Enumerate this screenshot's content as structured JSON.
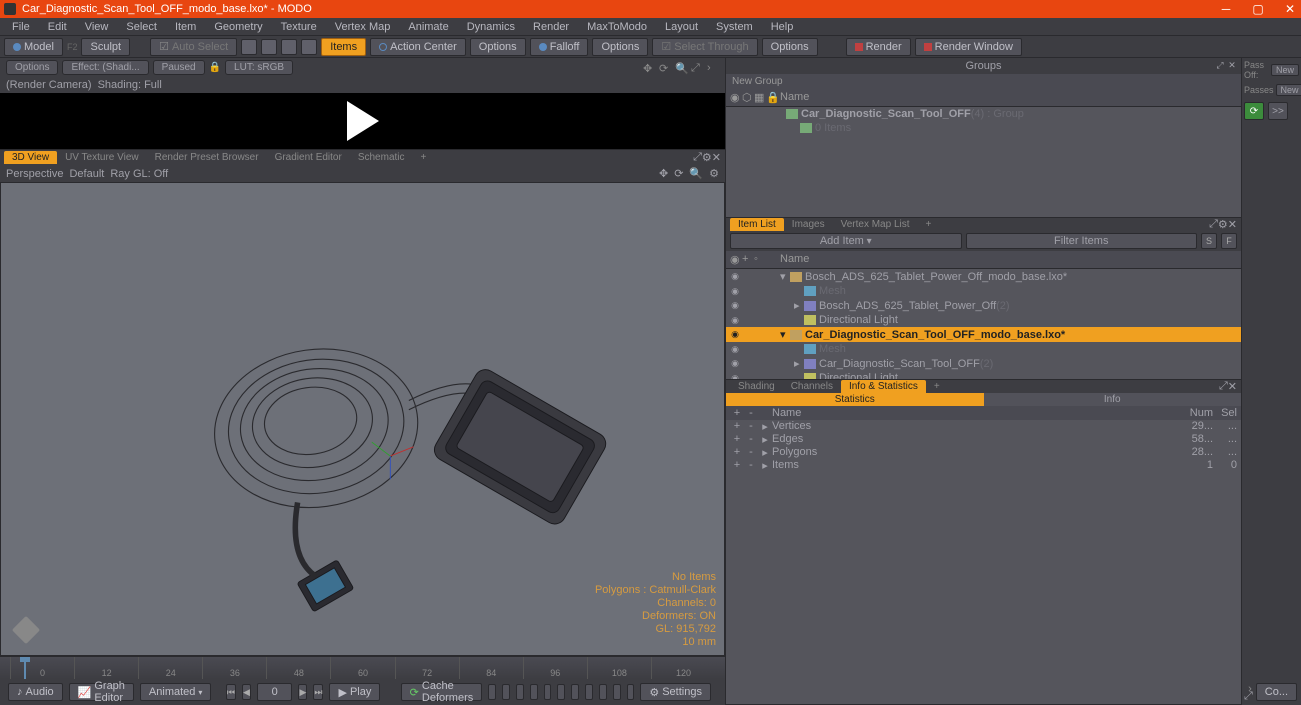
{
  "title": "Car_Diagnostic_Scan_Tool_OFF_modo_base.lxo* - MODO",
  "menus": [
    "File",
    "Edit",
    "View",
    "Select",
    "Item",
    "Geometry",
    "Texture",
    "Vertex Map",
    "Animate",
    "Dynamics",
    "Render",
    "MaxToModo",
    "Layout",
    "System",
    "Help"
  ],
  "toolbar": {
    "model": "Model",
    "model_key": "F2",
    "sculpt": "Sculpt",
    "auto_select": "Auto Select",
    "items": "Items",
    "action_center": "Action Center",
    "options1": "Options",
    "falloff": "Falloff",
    "options2": "Options",
    "select_through": "Select Through",
    "options3": "Options",
    "render": "Render",
    "render_window": "Render Window"
  },
  "preview_bar": {
    "options": "Options",
    "effect": "Effect: (Shadi...",
    "paused": "Paused",
    "lut": "LUT: sRGB",
    "render_camera": "(Render Camera)",
    "shading": "Shading: Full"
  },
  "viewport_tabs": [
    "3D View",
    "UV Texture View",
    "Render Preset Browser",
    "Gradient Editor",
    "Schematic"
  ],
  "viewport_sub": {
    "perspective": "Perspective",
    "default": "Default",
    "raygl": "Ray GL: Off"
  },
  "hud": {
    "no_items": "No Items",
    "polys": "Polygons : Catmull-Clark",
    "channels": "Channels: 0",
    "deformers": "Deformers: ON",
    "gl": "GL: 915,792",
    "grid": "10 mm"
  },
  "timeline": {
    "start": 0,
    "end": 120,
    "major": [
      0,
      12,
      24,
      36,
      48,
      60,
      72,
      84,
      96,
      108,
      120
    ]
  },
  "playbar": {
    "audio": "Audio",
    "graph_editor": "Graph Editor",
    "mode": "Animated",
    "frame": "0",
    "play": "Play",
    "cache": "Cache Deformers",
    "settings": "Settings"
  },
  "groups": {
    "title": "Groups",
    "new_group": "New Group",
    "header_name": "Name",
    "rows": [
      {
        "name": "Car_Diagnostic_Scan_Tool_OFF",
        "suffix": "(4) : Group"
      },
      {
        "name": "",
        "suffix": "0 Items",
        "indent": 1
      }
    ]
  },
  "right_strip": {
    "pass_off": "Pass Off:",
    "new1": "New",
    "passes": "Passes",
    "new2": "New",
    "fwd": ">>",
    "co": "Co..."
  },
  "item_list": {
    "tabs": [
      "Item List",
      "Images",
      "Vertex Map List"
    ],
    "add_item": "Add Item",
    "filter": "Filter Items",
    "header_name": "Name",
    "rows": [
      {
        "expander": "▾",
        "icon": "scene",
        "name": "Bosch_ADS_625_Tablet_Power_Off_modo_base.lxo*",
        "indent": 0
      },
      {
        "expander": "",
        "icon": "mesh",
        "name": "Mesh",
        "dim": true,
        "indent": 1
      },
      {
        "expander": "▸",
        "icon": "cam",
        "name": "Bosch_ADS_625_Tablet_Power_Off",
        "suffix": "(2)",
        "indent": 1
      },
      {
        "expander": "",
        "icon": "light",
        "name": "Directional Light",
        "indent": 1
      },
      {
        "expander": "▾",
        "icon": "scene",
        "name": "Car_Diagnostic_Scan_Tool_OFF_modo_base.lxo*",
        "selected": true,
        "bold": true,
        "indent": 0
      },
      {
        "expander": "",
        "icon": "mesh",
        "name": "Mesh",
        "dim": true,
        "indent": 1
      },
      {
        "expander": "▸",
        "icon": "cam",
        "name": "Car_Diagnostic_Scan_Tool_OFF",
        "suffix": "(2)",
        "indent": 1
      },
      {
        "expander": "",
        "icon": "light",
        "name": "Directional Light",
        "indent": 1
      }
    ]
  },
  "info_panel": {
    "tabs": [
      "Shading",
      "Channels",
      "Info & Statistics"
    ],
    "sub_tabs": [
      "Statistics",
      "Info"
    ],
    "header": {
      "name": "Name",
      "num": "Num",
      "sel": "Sel"
    },
    "rows": [
      {
        "name": "Vertices",
        "num": "29...",
        "sel": "..."
      },
      {
        "name": "Edges",
        "num": "58...",
        "sel": "..."
      },
      {
        "name": "Polygons",
        "num": "28...",
        "sel": "..."
      },
      {
        "name": "Items",
        "num": "1",
        "sel": "0"
      }
    ]
  }
}
